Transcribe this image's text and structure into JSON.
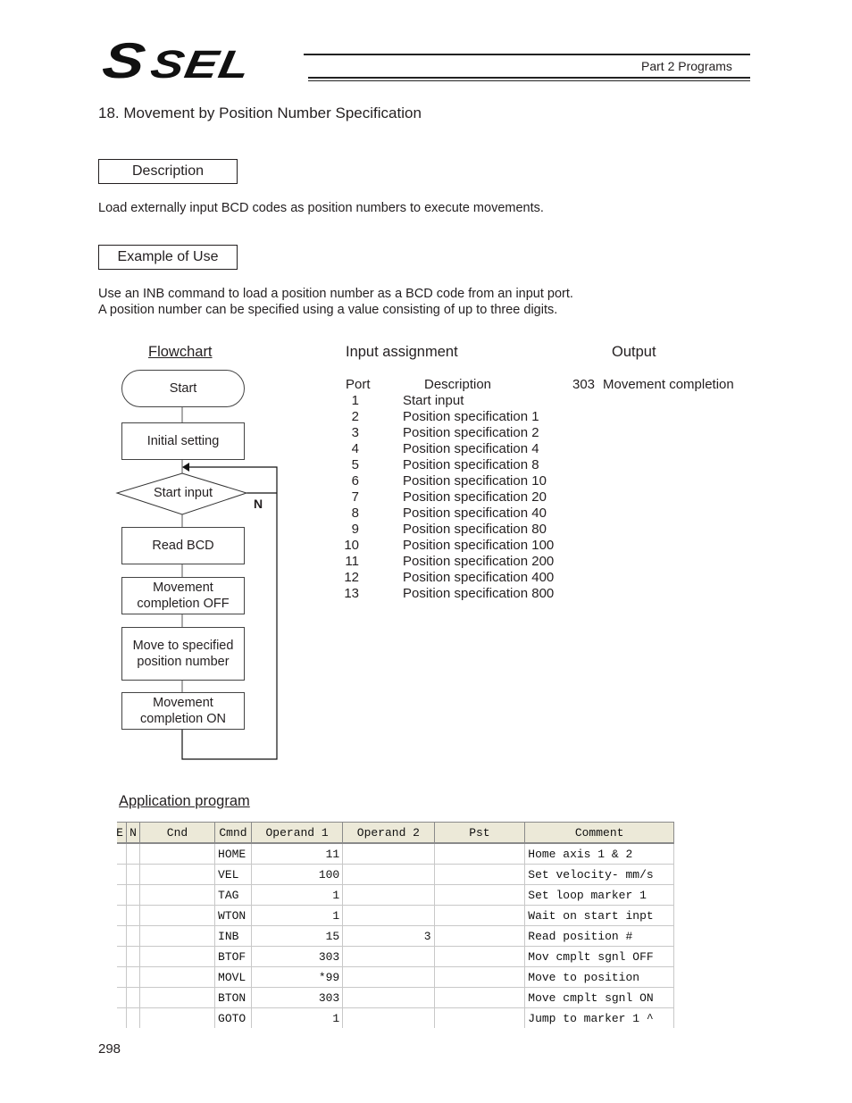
{
  "header": {
    "logo_s": "S",
    "logo_sel": "SEL",
    "part_label": "Part 2 Programs"
  },
  "section": {
    "title": "18.  Movement by Position Number Specification"
  },
  "description": {
    "label": "Description",
    "text": "Load externally input BCD codes as position numbers to execute movements."
  },
  "example": {
    "label": "Example of Use",
    "line1": "Use an INB command to load a position number as a BCD code from an input port.",
    "line2": "A position number can be specified using a value consisting of up to three digits."
  },
  "flowchart": {
    "title": "Flowchart",
    "nodes": [
      {
        "label": "Start"
      },
      {
        "label": "Initial setting"
      },
      {
        "label": "Start input"
      },
      {
        "label": "Read BCD"
      },
      {
        "label": "Movement completion OFF"
      },
      {
        "label": "Move to specified position number"
      },
      {
        "label": "Movement completion ON"
      }
    ],
    "branch_label": "N"
  },
  "input_assignment": {
    "title": "Input assignment",
    "col_port": "Port",
    "col_description": "Description",
    "rows": [
      {
        "port": "1",
        "description": "Start input"
      },
      {
        "port": "2",
        "description": "Position specification 1"
      },
      {
        "port": "3",
        "description": "Position specification 2"
      },
      {
        "port": "4",
        "description": "Position specification 4"
      },
      {
        "port": "5",
        "description": "Position specification 8"
      },
      {
        "port": "6",
        "description": "Position specification 10"
      },
      {
        "port": "7",
        "description": "Position specification 20"
      },
      {
        "port": "8",
        "description": "Position specification 40"
      },
      {
        "port": "9",
        "description": "Position specification 80"
      },
      {
        "port": "10",
        "description": "Position specification 100"
      },
      {
        "port": "11",
        "description": "Position specification 200"
      },
      {
        "port": "12",
        "description": "Position specification 400"
      },
      {
        "port": "13",
        "description": "Position specification 800"
      }
    ]
  },
  "output": {
    "title": "Output",
    "port": "303",
    "description": "Movement completion"
  },
  "program": {
    "title": "Application program",
    "columns": [
      "E",
      "N",
      "Cnd",
      "Cmnd",
      "Operand 1",
      "Operand 2",
      "Pst",
      "Comment"
    ],
    "rows": [
      {
        "e": "",
        "n": "",
        "cnd": "",
        "cmnd": "HOME",
        "op1": "11",
        "op2": "",
        "pst": "",
        "comment": "Home axis 1 & 2"
      },
      {
        "e": "",
        "n": "",
        "cnd": "",
        "cmnd": "VEL",
        "op1": "100",
        "op2": "",
        "pst": "",
        "comment": "Set velocity- mm/s"
      },
      {
        "e": "",
        "n": "",
        "cnd": "",
        "cmnd": "TAG",
        "op1": "1",
        "op2": "",
        "pst": "",
        "comment": "Set loop marker 1"
      },
      {
        "e": "",
        "n": "",
        "cnd": "",
        "cmnd": "WTON",
        "op1": "1",
        "op2": "",
        "pst": "",
        "comment": "Wait on start inpt"
      },
      {
        "e": "",
        "n": "",
        "cnd": "",
        "cmnd": "INB",
        "op1": "15",
        "op2": "3",
        "pst": "",
        "comment": "Read position #"
      },
      {
        "e": "",
        "n": "",
        "cnd": "",
        "cmnd": "BTOF",
        "op1": "303",
        "op2": "",
        "pst": "",
        "comment": "Mov cmplt sgnl OFF"
      },
      {
        "e": "",
        "n": "",
        "cnd": "",
        "cmnd": "MOVL",
        "op1": "*99",
        "op2": "",
        "pst": "",
        "comment": "Move to position"
      },
      {
        "e": "",
        "n": "",
        "cnd": "",
        "cmnd": "BTON",
        "op1": "303",
        "op2": "",
        "pst": "",
        "comment": "Move cmplt sgnl ON"
      },
      {
        "e": "",
        "n": "",
        "cnd": "",
        "cmnd": "GOTO",
        "op1": "1",
        "op2": "",
        "pst": "",
        "comment": "Jump to marker 1 ^"
      }
    ]
  },
  "footer": {
    "page_number": "298"
  }
}
